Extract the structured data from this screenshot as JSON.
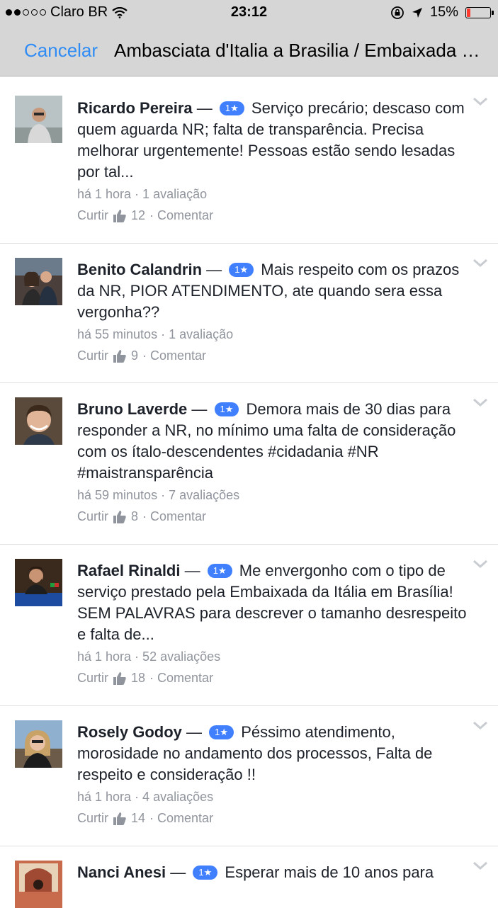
{
  "status": {
    "carrier": "Claro BR",
    "time": "23:12",
    "battery": "15%",
    "signal_bars": 2,
    "icons": [
      "wifi-icon",
      "lock-rotation-icon",
      "location-arrow-icon",
      "battery-icon"
    ]
  },
  "nav": {
    "cancel": "Cancelar",
    "title": "Ambasciata d'Italia a Brasilia / Embaixada da Itália em Brasília"
  },
  "colors": {
    "accent": "#2f8cf5",
    "badge": "#4080ff",
    "meta": "#90949c",
    "battery_low": "#ff3b30"
  },
  "reviews": [
    {
      "name": "Ricardo Pereira",
      "dash": "—",
      "rating": "1★",
      "text": "Serviço precário; descaso com quem aguarda NR; falta de transparência. Precisa melhorar urgentemente! Pessoas estão sendo lesadas por tal...",
      "meta": "há 1 hora · 1 avaliação",
      "like": "Curtir",
      "likes": "12",
      "comment": "· Comentar"
    },
    {
      "name": "Benito Calandrin",
      "dash": "—",
      "rating": "1★",
      "text": "Mais respeito com os prazos da NR, PIOR ATENDIMENTO, ate quando sera essa vergonha??",
      "meta": "há 55 minutos · 1 avaliação",
      "like": "Curtir",
      "likes": "9",
      "comment": "· Comentar"
    },
    {
      "name": "Bruno Laverde",
      "dash": "—",
      "rating": "1★",
      "text": "Demora mais de 30 dias para responder a NR, no mínimo uma falta de consideração com os ítalo-descendentes #cidadania #NR #maistransparência",
      "meta": "há 59 minutos · 7 avaliações",
      "like": "Curtir",
      "likes": "8",
      "comment": "· Comentar"
    },
    {
      "name": "Rafael Rinaldi",
      "dash": "—",
      "rating": "1★",
      "text": "Me envergonho com o tipo de serviço prestado pela Embaixada da Itália em Brasília! SEM PALAVRAS para descrever o tamanho desrespeito e falta de...",
      "meta": "há 1 hora · 52 avaliações",
      "like": "Curtir",
      "likes": "18",
      "comment": "· Comentar"
    },
    {
      "name": "Rosely Godoy",
      "dash": "—",
      "rating": "1★",
      "text": "Péssimo atendimento, morosidade no andamento dos processos, Falta de respeito e consideração !!",
      "meta": "há 1 hora · 4 avaliações",
      "like": "Curtir",
      "likes": "14",
      "comment": "· Comentar"
    },
    {
      "name": "Nanci Anesi",
      "dash": "—",
      "rating": "1★",
      "text": "Esperar mais de 10 anos para",
      "meta": "",
      "like": "",
      "likes": "",
      "comment": ""
    }
  ]
}
